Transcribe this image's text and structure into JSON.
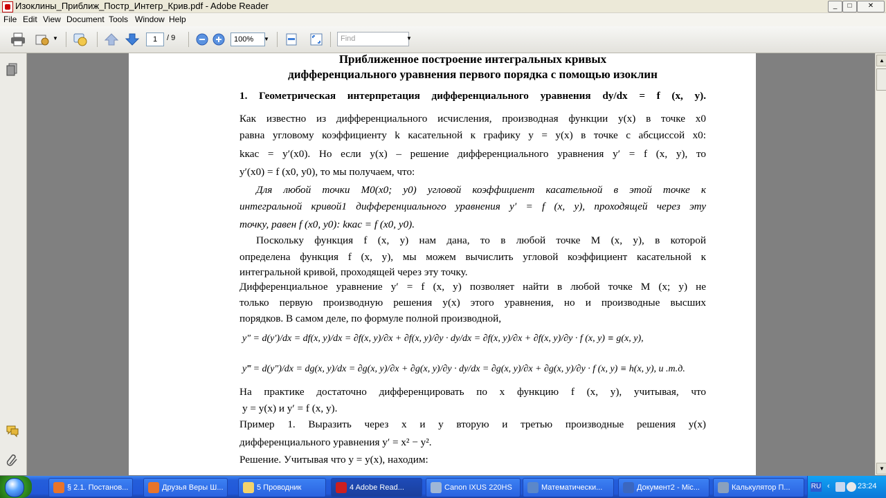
{
  "window": {
    "title": "Изоклины_Приближ_Постр_Интегр_Крив.pdf - Adobe Reader",
    "minimize": "_",
    "maximize": "□",
    "close": "✕"
  },
  "menu": [
    "File",
    "Edit",
    "View",
    "Document",
    "Tools",
    "Window",
    "Help"
  ],
  "toolbar": {
    "page_current": "1",
    "page_total": "/ 9",
    "zoom": "100%",
    "find_placeholder": "Find",
    "icons": [
      "print-icon",
      "email-icon",
      "review-icon",
      "page-up-icon",
      "page-down-icon",
      "zoom-out-icon",
      "zoom-in-icon",
      "fit-width-icon",
      "fit-page-icon"
    ]
  },
  "document": {
    "title1": "Приближенное построение интегральных кривых",
    "title2": "дифференциального уравнения первого порядка с помощью изоклин",
    "heading": "1.  Геометрическая  интерпретация  дифференциального  уравнения   dy/dx = f (x, y).",
    "lines": [
      "Как известно из дифференциального исчисления, производная функции  y(x)  в точке  x0",
      "равна угловому коэффициенту k касательной к графику  y = y(x)  в точке с абсциссой  x0:",
      "kкас = y′(x0).  Но  если  y(x)  –  решение  дифференциального  уравнения   y′ = f (x, y),  то",
      "y′(x0) = f (x0, y0), то мы получаем, что:",
      "Для  любой  точки  M0(x0; y0)  угловой  коэффициент  касательной  в  этой  точке  к",
      "интегральной кривой1  дифференциального уравнения  y′ = f (x, y), проходящей через эту",
      "точку, равен  f (x0, y0):  kкас = f (x0, y0).",
      "Поскольку  функция   f (x, y)   нам  дана,  то  в  любой  точке   M (x, y),   в  которой",
      "определена функция  f (x, y), мы можем вычислить угловой коэффициент касательной к",
      "интегральной кривой, проходящей через эту точку.",
      "Дифференциальное  уравнение   y′ = f (x, y)   позволяет  найти  в  любой  точке   M (x; y)   не",
      "только первую производную решения  y(x)  этого уравнения, но и производные высших",
      "порядков. В самом деле, по формуле полной производной,",
      "y″ = d(y′)/dx = df(x, y)/dx = ∂f(x, y)/∂x + ∂f(x, y)/∂y · dy/dx = ∂f(x, y)/∂x + ∂f(x, y)/∂y · f (x, y) ≡ g(x, y),",
      "y‴ = d(y″)/dx = dg(x, y)/dx = ∂g(x, y)/∂x + ∂g(x, y)/∂y · dy/dx = ∂g(x, y)/∂x + ∂g(x, y)/∂y · f (x, y) ≡ h(x, y), и .т.д.",
      "На  практике  достаточно  дифференцировать  по   x   функцию    f (x, y),   учитывая,   что",
      "y = y(x)  и  y′ = f (x, y).",
      "Пример  1.  Выразить  через   x   и   y   вторую  и  третью  производные  решения   y(x)",
      "дифференциального уравнения  y′ = x² − y².",
      "Решение. Учитывая что  y = y(x), находим:"
    ]
  },
  "taskbar": {
    "tasks": [
      {
        "label": "§ 2.1. Постанов...",
        "color": "#e8742a"
      },
      {
        "label": "Друзья Веры Ш...",
        "color": "#e8742a"
      },
      {
        "label": "5 Проводник",
        "color": "#f3d36b"
      },
      {
        "label": "4 Adobe Read...",
        "color": "#cc1f1f"
      },
      {
        "label": "Canon IXUS 220HS",
        "color": "#9fb7d6"
      },
      {
        "label": "Математически...",
        "color": "#5b87c9"
      },
      {
        "label": "Документ2 - Mic...",
        "color": "#3b67c0"
      },
      {
        "label": "Калькулятор П...",
        "color": "#8aa0bd"
      }
    ],
    "lang": "RU",
    "time": "23:24"
  }
}
